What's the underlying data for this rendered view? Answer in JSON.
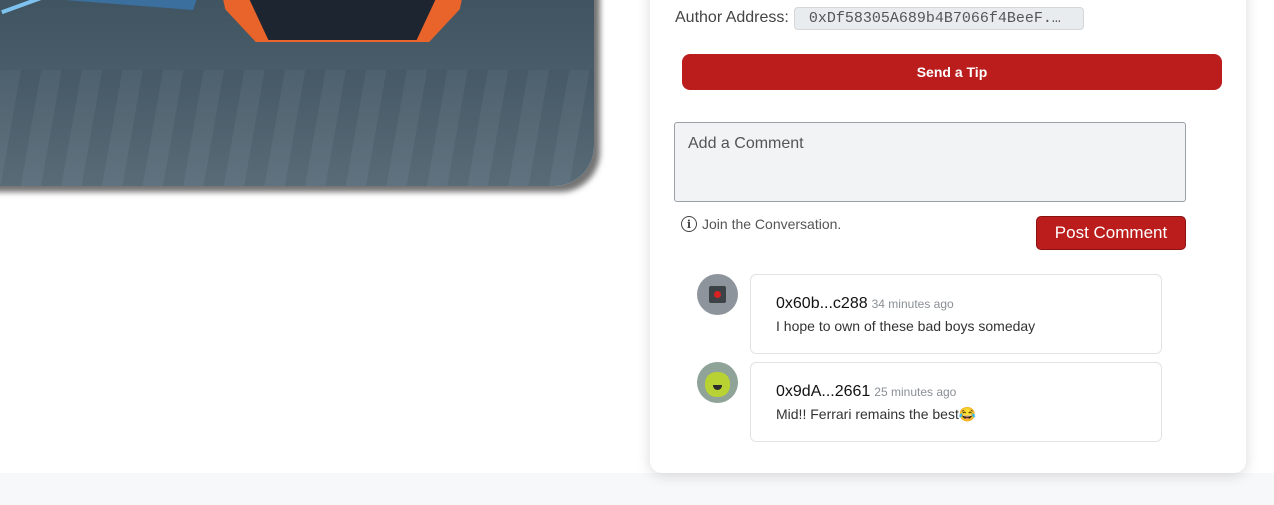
{
  "author": {
    "label": "Author Address:",
    "address": "0xDf58305A689b4B7066f4BeeF..."
  },
  "tip_button": {
    "label": "Send a Tip"
  },
  "comment_input": {
    "placeholder": "Add a Comment"
  },
  "join": {
    "icon": "info-icon",
    "text": "Join the Conversation."
  },
  "post_button": {
    "label": "Post Comment"
  },
  "comments": [
    {
      "user": "0x60b...c288",
      "time": "34 minutes ago",
      "text": "I hope to own of these bad boys someday",
      "avatar": "camera-avatar"
    },
    {
      "user": "0x9dA...2661",
      "time": "25 minutes ago",
      "text": "Mid!! Ferrari remains the best😂",
      "avatar": "green-face-avatar"
    }
  ],
  "colors": {
    "accent": "#bb1d1d",
    "card_border": "#e1e3e6",
    "input_bg": "#f2f3f5"
  }
}
